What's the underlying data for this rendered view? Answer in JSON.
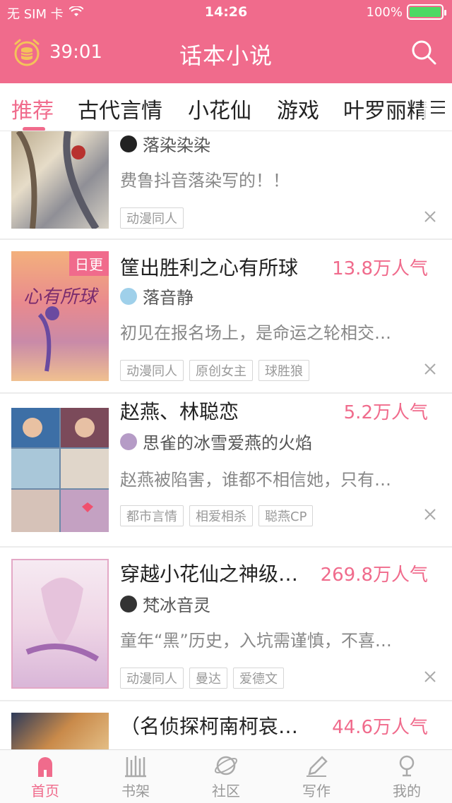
{
  "status_bar": {
    "carrier": "无 SIM 卡",
    "time": "14:26",
    "battery": "100%"
  },
  "header": {
    "timer": "39:01",
    "title": "话本小说"
  },
  "tabs": [
    {
      "label": "推荐"
    },
    {
      "label": "古代言情"
    },
    {
      "label": "小花仙"
    },
    {
      "label": "游戏"
    },
    {
      "label": "叶罗丽精"
    }
  ],
  "feed": [
    {
      "title": "",
      "popularity": "",
      "author": "落染染染",
      "description": "费鲁抖音落染写的！！",
      "tags": [
        "动漫同人"
      ]
    },
    {
      "badge": "日更",
      "cover_text": "心有所球",
      "title": "筐出胜利之心有所球",
      "popularity": "13.8万人气",
      "author": "落音静",
      "description": "初见在报名场上，是命运之轮相交…",
      "tags": [
        "动漫同人",
        "原创女主",
        "球胜狼"
      ]
    },
    {
      "title": "赵燕、林聪恋",
      "popularity": "5.2万人气",
      "author": "思雀的冰雪爱燕的火焰",
      "description": "赵燕被陷害，谁都不相信她，只有…",
      "tags": [
        "都市言情",
        "相爱相杀",
        "聪燕CP"
      ]
    },
    {
      "title": "穿越小花仙之神级…",
      "popularity": "269.8万人气",
      "author": "梵冰音灵",
      "description": "童年“黑”历史，入坑需谨慎，不喜…",
      "tags": [
        "动漫同人",
        "曼达",
        "爱德文"
      ]
    },
    {
      "title": "（名侦探柯南柯哀…",
      "popularity": "44.6万人气",
      "author": "",
      "description": "",
      "tags": []
    }
  ],
  "tabbar": [
    {
      "label": "首页"
    },
    {
      "label": "书架"
    },
    {
      "label": "社区"
    },
    {
      "label": "写作"
    },
    {
      "label": "我的"
    }
  ],
  "colors": {
    "brand": "#f06b8c",
    "battery": "#4cd964"
  }
}
